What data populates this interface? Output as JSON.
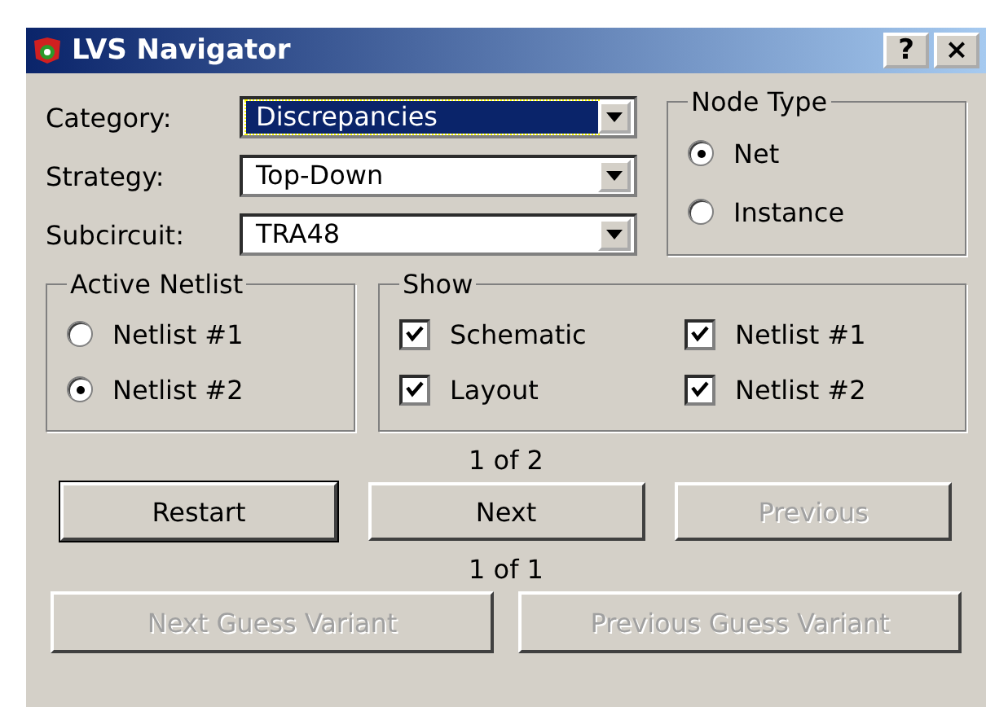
{
  "window": {
    "title": "LVS Navigator",
    "help_button": "?",
    "close_button": "×"
  },
  "fields": [
    {
      "label": "Category:",
      "value": "Discrepancies",
      "focused": true
    },
    {
      "label": "Strategy:",
      "value": "Top-Down",
      "focused": false
    },
    {
      "label": "Subcircuit:",
      "value": "TRA48",
      "focused": false
    }
  ],
  "node_type": {
    "title": "Node Type",
    "options": [
      {
        "label": "Net",
        "selected": true
      },
      {
        "label": "Instance",
        "selected": false
      }
    ]
  },
  "active_netlist": {
    "title": "Active Netlist",
    "options": [
      {
        "label": "Netlist #1",
        "selected": false
      },
      {
        "label": "Netlist #2",
        "selected": true
      }
    ]
  },
  "show": {
    "title": "Show",
    "options": [
      {
        "label": "Schematic",
        "checked": true
      },
      {
        "label": "Netlist #1",
        "checked": true
      },
      {
        "label": "Layout",
        "checked": true
      },
      {
        "label": "Netlist #2",
        "checked": true
      }
    ]
  },
  "counter_1": "1 of 2",
  "buttons_1": [
    {
      "label": "Restart",
      "default": true,
      "disabled": false
    },
    {
      "label": "Next",
      "default": false,
      "disabled": false
    },
    {
      "label": "Previous",
      "default": false,
      "disabled": true
    }
  ],
  "counter_2": "1 of 1",
  "buttons_2": [
    {
      "label": "Next Guess Variant",
      "default": false,
      "disabled": true
    },
    {
      "label": "Previous Guess Variant",
      "default": false,
      "disabled": true
    }
  ]
}
